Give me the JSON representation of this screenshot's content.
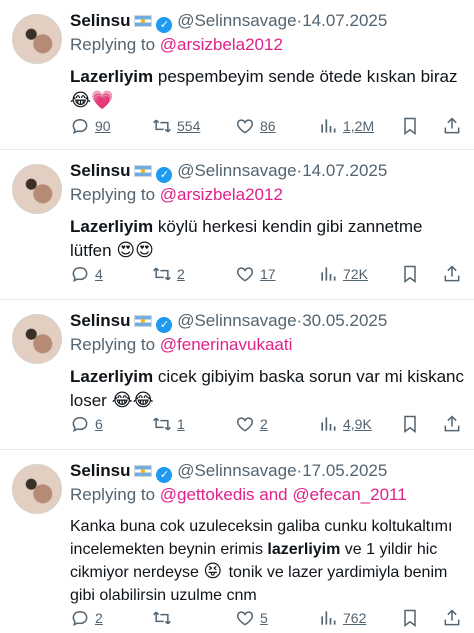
{
  "tweets": [
    {
      "name": "Selinsu",
      "handle": "@Selinnsavage",
      "date": "14.07.2025",
      "replying_prefix": "Replying to",
      "replying_to": "@arsizbela2012",
      "text_bold": "Lazerliyim",
      "text": " pespembeyim sende ötede kıskan biraz",
      "emojis": "😂💗",
      "replies": "90",
      "retweets": "554",
      "likes": "86",
      "views": "1,2M"
    },
    {
      "name": "Selinsu",
      "handle": "@Selinnsavage",
      "date": "14.07.2025",
      "replying_prefix": "Replying to",
      "replying_to": "@arsizbela2012",
      "text_bold": "Lazerliyim",
      "text": " köylü herkesi kendin gibi zannetme lütfen",
      "emojis": "😍😍",
      "replies": "4",
      "retweets": "2",
      "likes": "17",
      "views": "72K"
    },
    {
      "name": "Selinsu",
      "handle": "@Selinnsavage",
      "date": "30.05.2025",
      "replying_prefix": "Replying to",
      "replying_to": "@fenerinavukaati",
      "text_bold": "Lazerliyim",
      "text": " cicek gibiyim baska sorun var mi kiskanc loser",
      "emojis": "😂😂",
      "replies": "6",
      "retweets": "1",
      "likes": "2",
      "views": "4,9K"
    },
    {
      "name": "Selinsu",
      "handle": "@Selinnsavage",
      "date": "17.05.2025",
      "replying_prefix": "Replying to",
      "replying_to": "@gettokedis and @efecan_2011",
      "text_part1": "Kanka buna cok uzuleceksin galiba cunku koltukaltımı incelemekten beynin erimis ",
      "text_bold": "lazerliyim",
      "text_part2": " ve 1 yildir hic cikmiyor nerdeyse ",
      "emoji_mid": "😝",
      "text_part3": " tonik ve lazer yardimiyla benim gibi olabilirsin uzulme cnm",
      "replies": "2",
      "retweets": "",
      "likes": "5",
      "views": "762"
    }
  ],
  "colors": {
    "mention": "#e0218a",
    "verified": "#1d9bf0",
    "muted": "#536471"
  },
  "icons": [
    "argentina-flag-icon",
    "verified-badge-icon",
    "reply-icon",
    "retweet-icon",
    "like-icon",
    "views-icon",
    "bookmark-icon",
    "share-icon"
  ]
}
